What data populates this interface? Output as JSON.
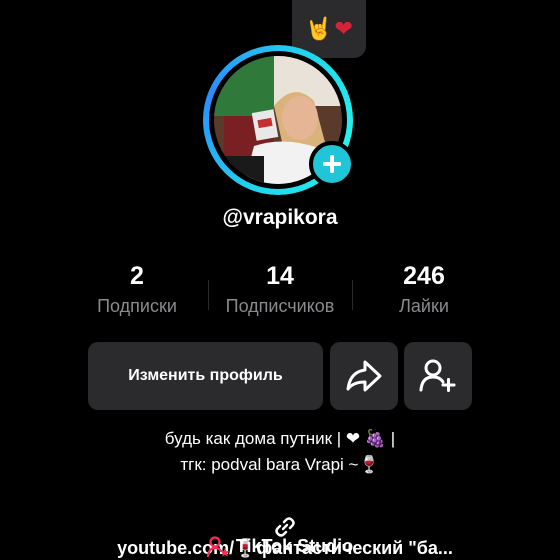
{
  "header": {
    "emoji_bubble": [
      "🤘",
      "❤"
    ]
  },
  "profile": {
    "username": "@vrapikora",
    "avatar_icon": "avatar-photo"
  },
  "stats": [
    {
      "value": "2",
      "label": "Подписки"
    },
    {
      "value": "14",
      "label": "Подписчиков"
    },
    {
      "value": "246",
      "label": "Лайки"
    }
  ],
  "actions": {
    "edit_label": "Изменить профиль",
    "share_icon": "share-icon",
    "add_friend_icon": "add-friend-icon"
  },
  "bio": {
    "line1": "будь как дома путник | ❤ 🍇 |",
    "line2": "тгк: podval bara Vrapi ~🍷"
  },
  "link": {
    "text": "youtube.com/🍷фантастический \"ба..."
  },
  "studio": {
    "label": "TikTok Studio"
  },
  "colors": {
    "accent": "#20c5d8",
    "button_bg": "#2b2b2d",
    "muted": "#8a8a8e",
    "studio_icon": "#fe2c55"
  }
}
